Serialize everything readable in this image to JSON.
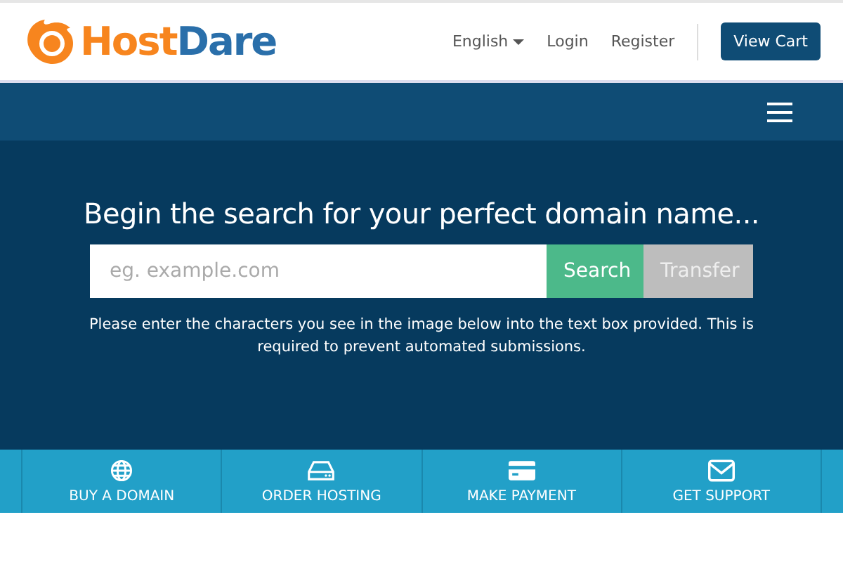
{
  "logo": {
    "part_1": "Host",
    "part_2": "Dare"
  },
  "top_nav": {
    "language": "English",
    "links": [
      "Login",
      "Register"
    ],
    "cart_button": "View Cart"
  },
  "hero": {
    "title": "Begin the search for your perfect domain name...",
    "search": {
      "placeholder": "eg. example.com"
    },
    "buttons": [
      {
        "label": "Search",
        "kind": "primary"
      },
      {
        "label": "Transfer",
        "kind": "secondary"
      }
    ],
    "notice": "Please enter the characters you see in the image below into the text box provided. This is required to prevent automated submissions."
  },
  "quick_links": [
    {
      "label": "BUY A DOMAIN"
    },
    {
      "label": "ORDER HOSTING"
    },
    {
      "label": "MAKE PAYMENT"
    },
    {
      "label": "GET SUPPORT"
    }
  ]
}
